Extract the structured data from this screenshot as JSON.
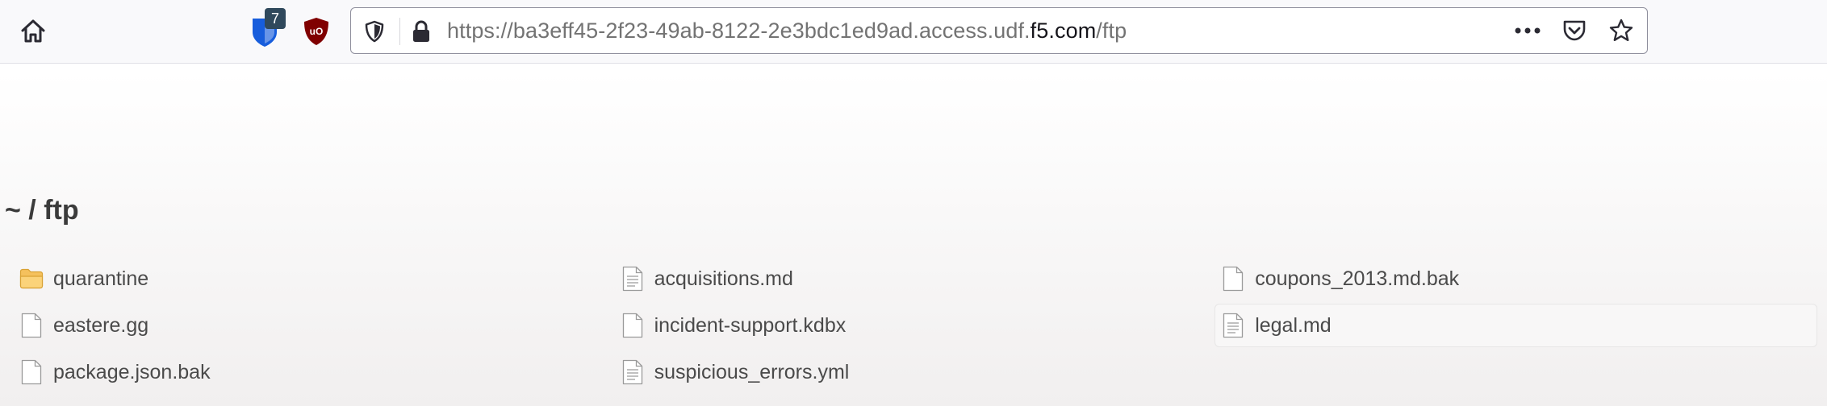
{
  "browser": {
    "url_prefix": "https://ba3eff45-2f23-49ab-8122-2e3bdc1ed9ad.access.udf.",
    "url_domain": "f5.com",
    "url_path": "/ftp",
    "extensions": {
      "bitwarden_badge": "7",
      "ublock_label": "uO"
    },
    "colors": {
      "bitwarden": "#175ddc",
      "badge": "#30495c",
      "ublock": "#800000"
    }
  },
  "page": {
    "breadcrumb": "~ / ftp",
    "files": [
      {
        "name": "quarantine",
        "icon": "folder-icon"
      },
      {
        "name": "acquisitions.md",
        "icon": "text-file-icon"
      },
      {
        "name": "coupons_2013.md.bak",
        "icon": "file-icon"
      },
      {
        "name": "eastere.gg",
        "icon": "file-icon"
      },
      {
        "name": "incident-support.kdbx",
        "icon": "file-icon"
      },
      {
        "name": "legal.md",
        "icon": "text-file-icon"
      },
      {
        "name": "package.json.bak",
        "icon": "file-icon"
      },
      {
        "name": "suspicious_errors.yml",
        "icon": "text-file-icon"
      }
    ]
  }
}
